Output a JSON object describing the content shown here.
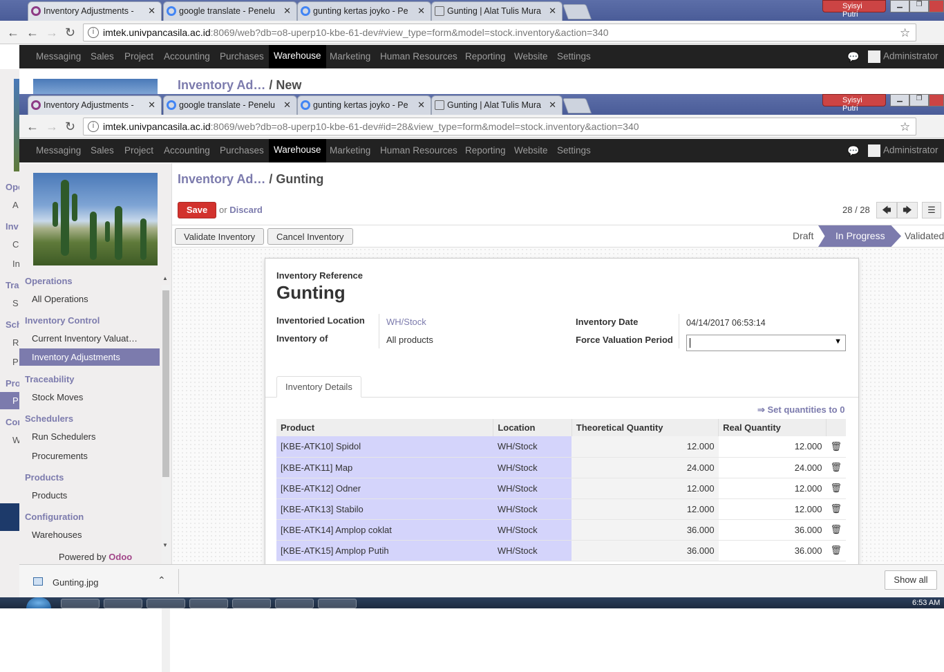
{
  "browser_back": {
    "tabs": [
      "Inventory Adjustments -",
      "google translate - Penelu",
      "gunting kertas joyko - Pe",
      "Gunting | Alat Tulis Mura"
    ],
    "user": "Syisyi Putri",
    "url_host": "imtek.univpancasila.ac.id",
    "url_rest": ":8069/web?db=o8-uperp10-kbe-61-dev#view_type=form&model=stock.inventory&action=340",
    "breadcrumb_link": "Inventory Ad…",
    "breadcrumb_sep": "/",
    "breadcrumb_current": "New"
  },
  "browser": {
    "tabs": [
      "Inventory Adjustments -",
      "google translate - Penelu",
      "gunting kertas joyko - Pe",
      "Gunting | Alat Tulis Mura"
    ],
    "user": "Syisyi Putri",
    "url_host": "imtek.univpancasila.ac.id",
    "url_rest": ":8069/web?db=o8-uperp10-kbe-61-dev#id=28&view_type=form&model=stock.inventory&action=340"
  },
  "menu": {
    "items": [
      "Messaging",
      "Sales",
      "Project",
      "Accounting",
      "Purchases",
      "Warehouse",
      "Marketing",
      "Human Resources",
      "Reporting",
      "Website",
      "Settings"
    ],
    "active": "Warehouse",
    "user": "Administrator"
  },
  "bg_sidebar_fragments": [
    "Ope",
    "A",
    "Inv",
    "C",
    "In",
    "Tra",
    "S",
    "Sch",
    "R",
    "P",
    "Pro",
    "P",
    "Con",
    "W"
  ],
  "sidebar": {
    "sections": [
      {
        "title": "Operations",
        "items": [
          "All Operations"
        ]
      },
      {
        "title": "Inventory Control",
        "items": [
          "Current Inventory Valuat…",
          "Inventory Adjustments"
        ]
      },
      {
        "title": "Traceability",
        "items": [
          "Stock Moves"
        ]
      },
      {
        "title": "Schedulers",
        "items": [
          "Run Schedulers",
          "Procurements"
        ]
      },
      {
        "title": "Products",
        "items": [
          "Products"
        ]
      },
      {
        "title": "Configuration",
        "items": [
          "Warehouses"
        ]
      }
    ],
    "active_item": "Inventory Adjustments",
    "powered_by": "Powered by",
    "powered_brand": "Odoo"
  },
  "breadcrumb": {
    "link": "Inventory Ad…",
    "sep": "/",
    "current": "Gunting"
  },
  "actions": {
    "save": "Save",
    "or": "or",
    "discard": "Discard"
  },
  "pager": {
    "text": "28 / 28"
  },
  "status_buttons": {
    "validate": "Validate Inventory",
    "cancel": "Cancel Inventory"
  },
  "stages": {
    "draft": "Draft",
    "in_progress": "In Progress",
    "validated": "Validated",
    "current": "In Progress"
  },
  "form": {
    "ref_label": "Inventory Reference",
    "ref_value": "Gunting",
    "location_label": "Inventoried Location",
    "location_value": "WH/Stock",
    "of_label": "Inventory of",
    "of_value": "All products",
    "date_label": "Inventory Date",
    "date_value": "04/14/2017 06:53:14",
    "period_label": "Force Valuation Period",
    "period_value": ""
  },
  "notebook": {
    "tab": "Inventory Details",
    "set_quantities": "⇒ Set quantities to 0"
  },
  "table": {
    "headers": [
      "Product",
      "Location",
      "Theoretical Quantity",
      "Real Quantity"
    ],
    "rows": [
      {
        "product": "[KBE-ATK10] Spidol",
        "location": "WH/Stock",
        "theoretical": "12.000",
        "real": "12.000"
      },
      {
        "product": "[KBE-ATK11] Map",
        "location": "WH/Stock",
        "theoretical": "24.000",
        "real": "24.000"
      },
      {
        "product": "[KBE-ATK12] Odner",
        "location": "WH/Stock",
        "theoretical": "12.000",
        "real": "12.000"
      },
      {
        "product": "[KBE-ATK13] Stabilo",
        "location": "WH/Stock",
        "theoretical": "12.000",
        "real": "12.000"
      },
      {
        "product": "[KBE-ATK14] Amplop coklat",
        "location": "WH/Stock",
        "theoretical": "36.000",
        "real": "36.000"
      },
      {
        "product": "[KBE-ATK15] Amplop Putih",
        "location": "WH/Stock",
        "theoretical": "36.000",
        "real": "36.000"
      }
    ]
  },
  "download": {
    "file": "Gunting.jpg",
    "show_all": "Show all"
  },
  "taskbar": {
    "time": "6:53 AM"
  },
  "colors": {
    "accent": "#7c7bad",
    "save": "#d2322d",
    "menu_bg": "#222222",
    "readonly_row": "#d4d4fb"
  }
}
